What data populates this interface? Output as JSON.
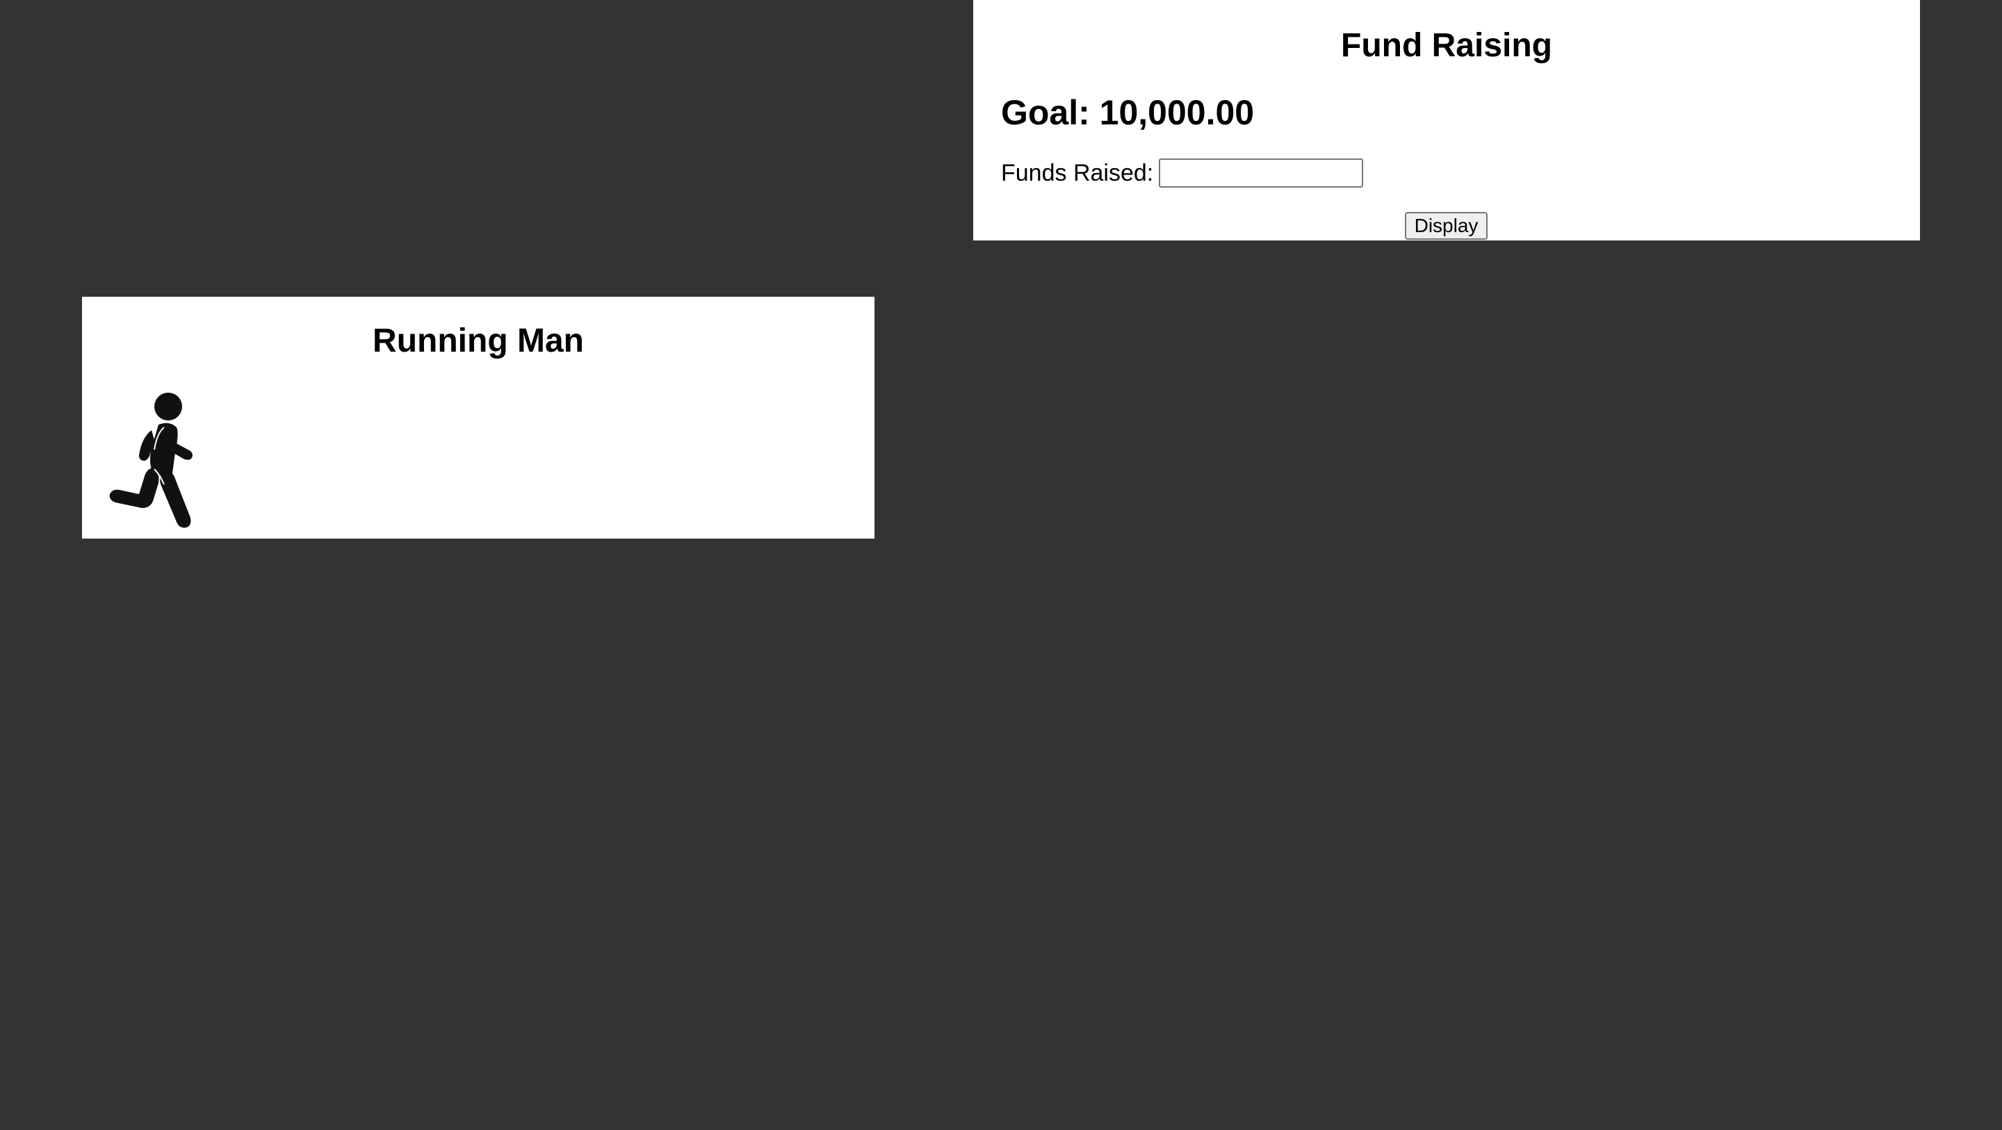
{
  "fund_raising": {
    "title": "Fund Raising",
    "goal": "Goal: 10,000.00",
    "funds_raised_label": "Funds Raised:",
    "funds_raised_value": "",
    "display_button": "Display"
  },
  "running_man": {
    "title": "Running Man",
    "icon": "running-man-icon"
  },
  "colors": {
    "background": "#333333",
    "panel": "#ffffff",
    "text": "#000000"
  }
}
